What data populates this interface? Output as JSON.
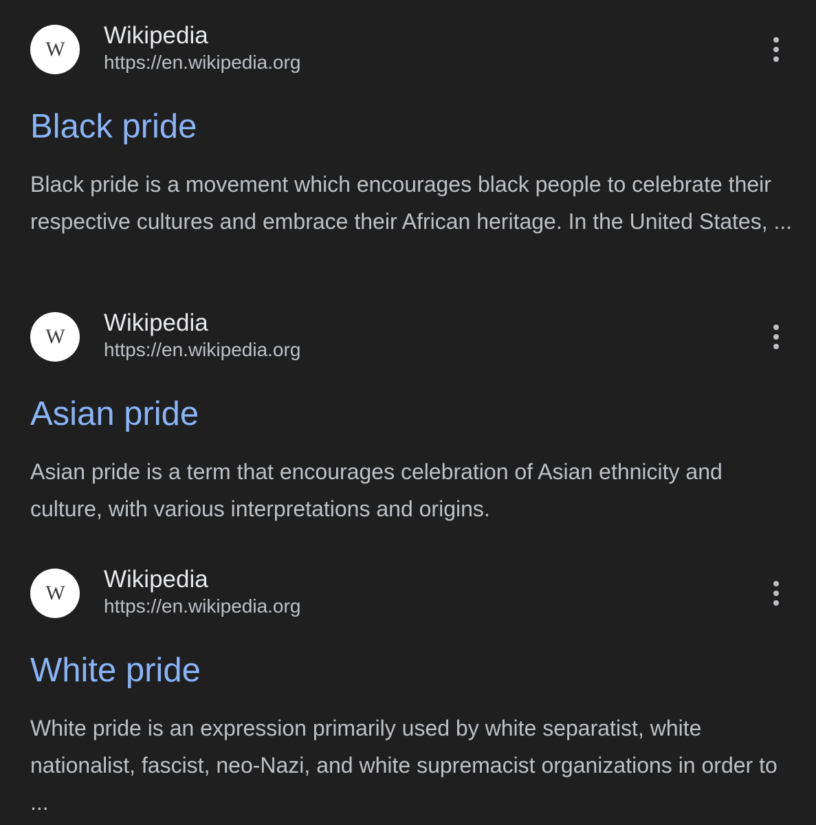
{
  "results": [
    {
      "favicon_letter": "W",
      "site_name": "Wikipedia",
      "url": "https://en.wikipedia.org",
      "title": "Black pride",
      "snippet": "Black pride is a movement which encourages black people to celebrate their respective cultures and embrace their African heritage. In the United States, ..."
    },
    {
      "favicon_letter": "W",
      "site_name": "Wikipedia",
      "url": "https://en.wikipedia.org",
      "title": "Asian pride",
      "snippet": "Asian pride is a term that encourages celebration of Asian ethnicity and culture, with various interpretations and origins."
    },
    {
      "favicon_letter": "W",
      "site_name": "Wikipedia",
      "url": "https://en.wikipedia.org",
      "title": "White pride",
      "snippet": "White pride is an expression primarily used by white separatist, white nationalist, fascist, neo-Nazi, and white supremacist organizations in order to ..."
    }
  ],
  "icons": {
    "favicon": "wikipedia-logo-icon",
    "menu": "more-vert-icon"
  },
  "colors": {
    "background": "#1f1f1f",
    "title_link": "#8ab4f8",
    "site_name": "#e8eaed",
    "body_text": "#bdc1c6"
  }
}
